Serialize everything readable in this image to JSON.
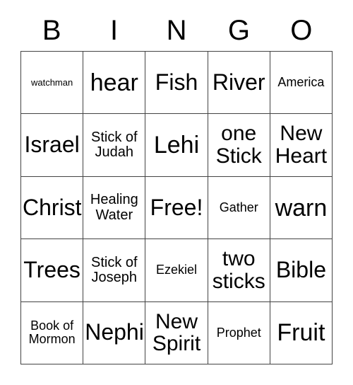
{
  "card": {
    "title": "BINGO",
    "header_letters": [
      "B",
      "I",
      "N",
      "G",
      "O"
    ],
    "colors": {
      "background": "#ffffff",
      "text": "#000000",
      "grid_line": "#444444"
    },
    "grid": {
      "columns": 5,
      "rows": 5,
      "rows_data": [
        [
          {
            "text": "watchman",
            "size": "xs"
          },
          {
            "text": "hear",
            "size": "xxxl"
          },
          {
            "text": "Fish",
            "size": "xxl"
          },
          {
            "text": "River",
            "size": "xxl"
          },
          {
            "text": "America",
            "size": "sm"
          }
        ],
        [
          {
            "text": "Israel",
            "size": "xxl"
          },
          {
            "text": "Stick of\nJudah",
            "size": "md"
          },
          {
            "text": "Lehi",
            "size": "xxxl"
          },
          {
            "text": "one\nStick",
            "size": "xl"
          },
          {
            "text": "New\nHeart",
            "size": "xl"
          }
        ],
        [
          {
            "text": "Christ",
            "size": "xxl"
          },
          {
            "text": "Healing\nWater",
            "size": "md"
          },
          {
            "text": "Free!",
            "size": "xxl"
          },
          {
            "text": "Gather",
            "size": "sm"
          },
          {
            "text": "warn",
            "size": "xxxl"
          }
        ],
        [
          {
            "text": "Trees",
            "size": "xxl"
          },
          {
            "text": "Stick of\nJoseph",
            "size": "md"
          },
          {
            "text": "Ezekiel",
            "size": "sm"
          },
          {
            "text": "two\nsticks",
            "size": "xl"
          },
          {
            "text": "Bible",
            "size": "xxl"
          }
        ],
        [
          {
            "text": "Book of\nMormon",
            "size": "sm"
          },
          {
            "text": "Nephi",
            "size": "xxl"
          },
          {
            "text": "New\nSpirit",
            "size": "xl"
          },
          {
            "text": "Prophet",
            "size": "sm"
          },
          {
            "text": "Fruit",
            "size": "xxxl"
          }
        ]
      ]
    }
  }
}
